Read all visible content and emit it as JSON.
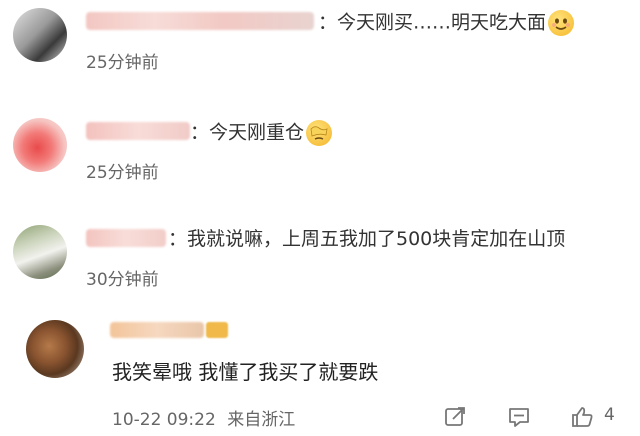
{
  "comments": [
    {
      "text": "：今天刚买……明天吃大面",
      "time": "25分钟前",
      "emoji": "shy-smile-emoji"
    },
    {
      "text": "：今天刚重仓",
      "time": "25分钟前",
      "emoji": "facepalm-emoji"
    },
    {
      "text": "：我就说嘛，上周五我加了500块肯定加在山顶",
      "time": "30分钟前"
    }
  ],
  "reply": {
    "text": "我笑晕哦 我懂了我买了就要跌",
    "datetime": "10-22 09:22",
    "location": "来自浙江",
    "like_count": "4"
  },
  "colors": {
    "text": "#333333",
    "meta": "#666666",
    "icon": "#777777",
    "emoji": "#f7c23a"
  },
  "icons": [
    "share-icon",
    "comment-icon",
    "like-icon"
  ]
}
